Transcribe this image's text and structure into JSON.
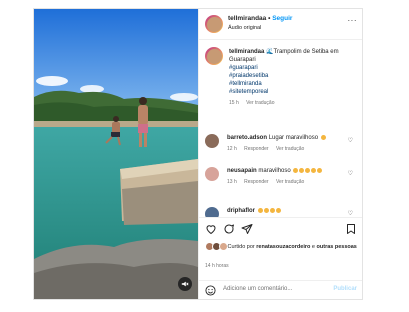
{
  "post": {
    "username": "tellmirandaa",
    "separator": "•",
    "follow_label": "Seguir",
    "audio": "Áudio original",
    "more": "···"
  },
  "caption": {
    "username": "tellmirandaa",
    "text": "🌊Trampolim de Setiba em Guarapari",
    "tags": [
      "#guarapari",
      "#praiadesetiba",
      "#tellmiranda",
      "#sitetemporeal"
    ],
    "time": "15 h",
    "translate": "Ver tradução"
  },
  "comments": [
    {
      "username": "barreto.adson",
      "text": "Lugar maravilhoso",
      "time": "12 h",
      "reply": "Responder",
      "translate": "Ver tradução",
      "avatar_color": "#8a6b5a"
    },
    {
      "username": "neusapain",
      "text": "maravilhoso",
      "time": "13 h",
      "reply": "Responder",
      "translate": "Ver tradução",
      "avatar_color": "#d7a39a"
    },
    {
      "username": "driphaflor",
      "text": "",
      "time": "",
      "reply": "",
      "translate": "",
      "avatar_color": "#4f6b8f"
    }
  ],
  "actions": {
    "liked_by_prefix": "Curtido por",
    "liked_by_user": "renatasouzacordeiro",
    "and": "e",
    "others": "outras pessoas",
    "time": "14 h",
    "time_suffix": "horas"
  },
  "comment_box": {
    "placeholder": "Adicione um comentário...",
    "publish": "Publicar"
  },
  "colors": {
    "accent": "#0095f6",
    "hashtag": "#00376b",
    "muted": "#737373"
  }
}
